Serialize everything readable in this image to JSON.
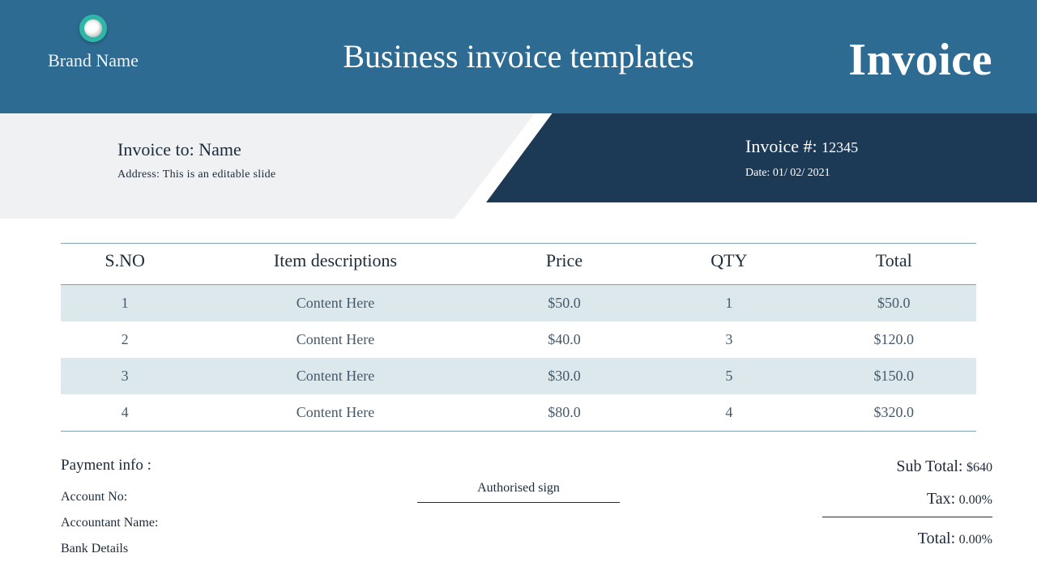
{
  "brand": {
    "name": "Brand Name"
  },
  "page": {
    "title": "Business invoice templates",
    "docword": "Invoice"
  },
  "billto": {
    "label": "Invoice to:",
    "name": "Name",
    "address_label": "Address:",
    "address": "This is an editable slide"
  },
  "meta": {
    "invno_label": "Invoice #:",
    "invno": "12345",
    "date_label": "Date:",
    "date": "01/ 02/ 2021"
  },
  "table": {
    "headers": {
      "sno": "S.NO",
      "desc": "Item descriptions",
      "price": "Price",
      "qty": "QTY",
      "total": "Total"
    },
    "rows": [
      {
        "sno": "1",
        "desc": "Content Here",
        "price": "$50.0",
        "qty": "1",
        "total": "$50.0"
      },
      {
        "sno": "2",
        "desc": "Content Here",
        "price": "$40.0",
        "qty": "3",
        "total": "$120.0"
      },
      {
        "sno": "3",
        "desc": "Content Here",
        "price": "$30.0",
        "qty": "5",
        "total": "$150.0"
      },
      {
        "sno": "4",
        "desc": "Content Here",
        "price": "$80.0",
        "qty": "4",
        "total": "$320.0"
      }
    ]
  },
  "payment": {
    "heading": "Payment info :",
    "account_no_label": "Account No:",
    "accountant_label": "Accountant Name:",
    "bank_label": "Bank Details"
  },
  "signature": {
    "label": "Authorised sign"
  },
  "totals": {
    "subtotal_label": "Sub Total:",
    "subtotal": "$640",
    "tax_label": "Tax:",
    "tax": "0.00%",
    "total_label": "Total:",
    "total": "0.00%"
  }
}
